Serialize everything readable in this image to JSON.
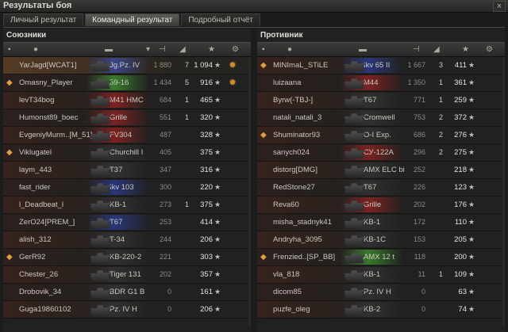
{
  "window": {
    "title": "Результаты боя",
    "close_label": "×"
  },
  "tabs": [
    {
      "label": "Личный результат",
      "active": false
    },
    {
      "label": "Командный результат",
      "active": true
    },
    {
      "label": "Подробный отчёт",
      "active": false
    }
  ],
  "teams": {
    "allies": {
      "title": "Союзники",
      "rows": [
        {
          "medal": "",
          "name": "YarJagd[WCAT1]",
          "tank": "Jg.Pz. IV",
          "tank_color": "#3a4a9a",
          "damage": "1 880",
          "frags": "7",
          "xp": "1 094",
          "achievement": true,
          "highlight": true
        },
        {
          "medal": "◆",
          "name": "Omasny_Player",
          "tank": "59-16",
          "tank_color": "#3e8a2e",
          "damage": "1 434",
          "frags": "5",
          "xp": "916",
          "achievement": true,
          "highlight": false
        },
        {
          "medal": "",
          "name": "levT34bog",
          "tank": "M41 HMC",
          "tank_color": "#8a2222",
          "damage": "684",
          "frags": "1",
          "xp": "465",
          "achievement": false,
          "highlight": false
        },
        {
          "medal": "",
          "name": "Humonst89_boec",
          "tank": "Grille",
          "tank_color": "#8a2222",
          "damage": "551",
          "frags": "1",
          "xp": "320",
          "achievement": false,
          "highlight": false
        },
        {
          "medal": "",
          "name": "EvgeniyMurm..[M_51]",
          "tank": "FV304",
          "tank_color": "#8a2222",
          "damage": "487",
          "frags": "",
          "xp": "328",
          "achievement": false,
          "highlight": false
        },
        {
          "medal": "◆",
          "name": "Viklugatel",
          "tank": "Churchill I",
          "tank_color": "#333",
          "damage": "405",
          "frags": "",
          "xp": "375",
          "achievement": false,
          "highlight": false
        },
        {
          "medal": "",
          "name": "laym_443",
          "tank": "T37",
          "tank_color": "#333",
          "damage": "347",
          "frags": "",
          "xp": "316",
          "achievement": false,
          "highlight": false
        },
        {
          "medal": "",
          "name": "fast_rider",
          "tank": "Ikv 103",
          "tank_color": "#2a3a8a",
          "damage": "300",
          "frags": "",
          "xp": "220",
          "achievement": false,
          "highlight": false
        },
        {
          "medal": "",
          "name": "l_Deadbeat_l",
          "tank": "KB-1",
          "tank_color": "#333",
          "damage": "273",
          "frags": "1",
          "xp": "375",
          "achievement": false,
          "highlight": false
        },
        {
          "medal": "",
          "name": "ZerO24[PREM_]",
          "tank": "T67",
          "tank_color": "#2a3a8a",
          "damage": "253",
          "frags": "",
          "xp": "414",
          "achievement": false,
          "highlight": false
        },
        {
          "medal": "",
          "name": "alish_312",
          "tank": "T-34",
          "tank_color": "#333",
          "damage": "244",
          "frags": "",
          "xp": "206",
          "achievement": false,
          "highlight": false
        },
        {
          "medal": "◆",
          "name": "GerR92",
          "tank": "KB-220-2",
          "tank_color": "#333",
          "damage": "221",
          "frags": "",
          "xp": "303",
          "achievement": false,
          "highlight": false
        },
        {
          "medal": "",
          "name": "Chester_26",
          "tank": "Tiger 131",
          "tank_color": "#333",
          "damage": "202",
          "frags": "",
          "xp": "357",
          "achievement": false,
          "highlight": false
        },
        {
          "medal": "",
          "name": "Drobovik_34",
          "tank": "BDR G1 B",
          "tank_color": "#333",
          "damage": "0",
          "frags": "",
          "xp": "161",
          "achievement": false,
          "highlight": false
        },
        {
          "medal": "",
          "name": "Guga19860102",
          "tank": "Pz. IV H",
          "tank_color": "#333",
          "damage": "0",
          "frags": "",
          "xp": "206",
          "achievement": false,
          "highlight": false
        }
      ]
    },
    "enemies": {
      "title": "Противник",
      "rows": [
        {
          "medal": "◆",
          "name": "MINImaL_STiLE",
          "tank": "Ikv 65 II",
          "tank_color": "#2a3a8a",
          "damage": "1 667",
          "frags": "3",
          "xp": "411",
          "achievement": false,
          "highlight": false
        },
        {
          "medal": "",
          "name": "luizaana",
          "tank": "M44",
          "tank_color": "#8a2222",
          "damage": "1 350",
          "frags": "1",
          "xp": "361",
          "achievement": false,
          "highlight": false
        },
        {
          "medal": "",
          "name": "Byrw(-TBJ-]",
          "tank": "T67",
          "tank_color": "#333",
          "damage": "771",
          "frags": "1",
          "xp": "259",
          "achievement": false,
          "highlight": false
        },
        {
          "medal": "",
          "name": "natali_natali_3",
          "tank": "Cromwell",
          "tank_color": "#333",
          "damage": "753",
          "frags": "2",
          "xp": "372",
          "achievement": false,
          "highlight": false
        },
        {
          "medal": "◆",
          "name": "Shuminator93",
          "tank": "O-I Exp.",
          "tank_color": "#333",
          "damage": "686",
          "frags": "2",
          "xp": "276",
          "achievement": false,
          "highlight": false
        },
        {
          "medal": "",
          "name": "sanych024",
          "tank": "СУ-122А",
          "tank_color": "#8a2222",
          "damage": "296",
          "frags": "2",
          "xp": "275",
          "achievement": false,
          "highlight": false
        },
        {
          "medal": "",
          "name": "distorg[DMG]",
          "tank": "AMX ELC bis",
          "tank_color": "#333",
          "damage": "252",
          "frags": "",
          "xp": "218",
          "achievement": false,
          "highlight": false
        },
        {
          "medal": "",
          "name": "RedStone27",
          "tank": "T67",
          "tank_color": "#333",
          "damage": "226",
          "frags": "",
          "xp": "123",
          "achievement": false,
          "highlight": false
        },
        {
          "medal": "",
          "name": "Reva60",
          "tank": "Grille",
          "tank_color": "#8a2222",
          "damage": "202",
          "frags": "",
          "xp": "176",
          "achievement": false,
          "highlight": false
        },
        {
          "medal": "",
          "name": "misha_stadnyk41",
          "tank": "KB-1",
          "tank_color": "#333",
          "damage": "172",
          "frags": "",
          "xp": "110",
          "achievement": false,
          "highlight": false
        },
        {
          "medal": "",
          "name": "Andryha_3095",
          "tank": "KB-1C",
          "tank_color": "#333",
          "damage": "153",
          "frags": "",
          "xp": "205",
          "achievement": false,
          "highlight": false
        },
        {
          "medal": "◆",
          "name": "Frenzied..[SP_BB]",
          "tank": "AMX 12 t",
          "tank_color": "#3e8a2e",
          "damage": "118",
          "frags": "",
          "xp": "200",
          "achievement": false,
          "highlight": false
        },
        {
          "medal": "",
          "name": "vla_818",
          "tank": "KB-1",
          "tank_color": "#333",
          "damage": "11",
          "frags": "1",
          "xp": "109",
          "achievement": false,
          "highlight": false
        },
        {
          "medal": "",
          "name": "dicom85",
          "tank": "Pz. IV H",
          "tank_color": "#333",
          "damage": "0",
          "frags": "",
          "xp": "63",
          "achievement": false,
          "highlight": false
        },
        {
          "medal": "",
          "name": "puzfe_oleg",
          "tank": "KB-2",
          "tank_color": "#333",
          "damage": "0",
          "frags": "",
          "xp": "74",
          "achievement": false,
          "highlight": false
        }
      ]
    }
  },
  "header_icons": [
    "squad-icon",
    "player-icon",
    "tier-sort-icon",
    "tank-icon",
    "damage-icon",
    "frags-icon",
    "xp-icon",
    "star-icon"
  ],
  "star_glyph": "★",
  "achievement_glyph": "✹"
}
